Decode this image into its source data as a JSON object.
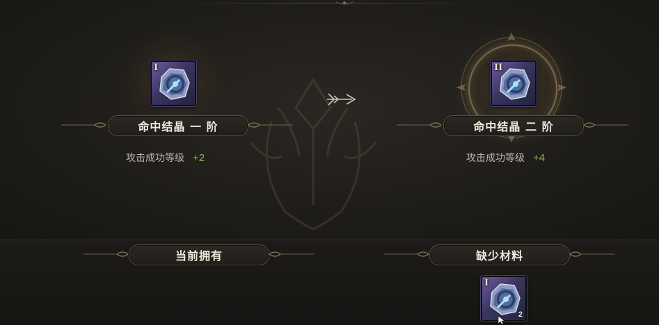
{
  "current": {
    "tier": "I",
    "name": "命中结晶 一 阶",
    "stat_label": "攻击成功等级",
    "stat_value": "+2"
  },
  "next": {
    "tier": "II",
    "name": "命中结晶 二 阶",
    "stat_label": "攻击成功等级",
    "stat_value": "+4"
  },
  "owned_section": {
    "title": "当前拥有"
  },
  "missing_section": {
    "title": "缺少材料",
    "material": {
      "tier": "I",
      "quantity": "2"
    }
  },
  "colors": {
    "stat_positive": "#86b84c",
    "gem_glow": "#4fc3ff",
    "gold_trim": "#8a7a5a"
  }
}
